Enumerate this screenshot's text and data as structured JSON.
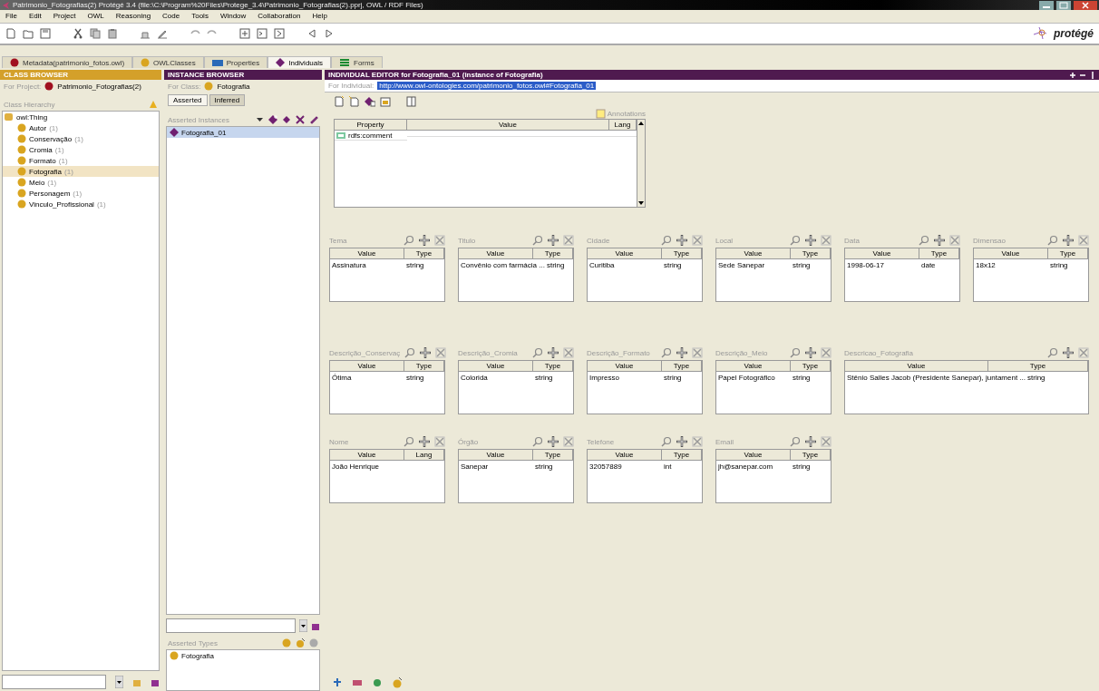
{
  "window": {
    "title": "Patrimonio_Fotografias(2)  Protégé 3.4    (file:\\C:\\Program%20Files\\Protege_3.4\\Patrimonio_Fotografias(2).pprj, OWL / RDF Files)"
  },
  "menu": [
    "File",
    "Edit",
    "Project",
    "OWL",
    "Reasoning",
    "Code",
    "Tools",
    "Window",
    "Collaboration",
    "Help"
  ],
  "logo": {
    "text": "protégé"
  },
  "tabs": [
    {
      "label": "Metadata(patrimonio_fotos.owl)",
      "kind": "metadata",
      "selected": false
    },
    {
      "label": "OWLClasses",
      "kind": "classes",
      "selected": false
    },
    {
      "label": "Properties",
      "kind": "properties",
      "selected": false
    },
    {
      "label": "Individuals",
      "kind": "individuals",
      "selected": true
    },
    {
      "label": "Forms",
      "kind": "forms",
      "selected": false
    }
  ],
  "class_browser": {
    "header": "CLASS BROWSER",
    "project_label": "For Project:",
    "project": "Patrimonio_Fotografias(2)",
    "hierarchy_label": "Class Hierarchy",
    "tree": [
      {
        "label": "owl:Thing",
        "selected": false,
        "children": [
          {
            "label": "Autor",
            "count": "(1)",
            "selected": false
          },
          {
            "label": "Conservação",
            "count": "(1)",
            "selected": false
          },
          {
            "label": "Cromia",
            "count": "(1)",
            "selected": false
          },
          {
            "label": "Formato",
            "count": "(1)",
            "selected": false
          },
          {
            "label": "Fotografia",
            "count": "(1)",
            "selected": true
          },
          {
            "label": "Meio",
            "count": "(1)",
            "selected": false
          },
          {
            "label": "Personagem",
            "count": "(1)",
            "selected": false
          },
          {
            "label": "Vinculo_Profissional",
            "count": "(1)",
            "selected": false
          }
        ]
      }
    ]
  },
  "instance_browser": {
    "header": "INSTANCE BROWSER",
    "class_label": "For Class:",
    "class": "Fotografia",
    "tabs": [
      {
        "label": "Asserted",
        "selected": true
      },
      {
        "label": "Inferred",
        "selected": false
      }
    ],
    "list_label": "Asserted Instances",
    "instances": [
      {
        "label": "Fotografia_01",
        "selected": true
      }
    ],
    "types_label": "Asserted Types",
    "types": [
      "Fotografia"
    ]
  },
  "editor": {
    "header": "INDIVIDUAL EDITOR for Fotografia_01   (instance of Fotografia)",
    "individual_label": "For Individual:",
    "individual": "http://www.owl-ontologies.com/patrimonio_fotos.owl#Fotografia_01",
    "annotations_label": "Annotations",
    "annotation_columns": [
      "Property",
      "Value",
      "Lang"
    ],
    "annotation_rows": [
      {
        "property": "rdfs:comment"
      }
    ],
    "widget_rows": [
      [
        {
          "label": "Tema",
          "kind": "normal",
          "columns": [
            "Value",
            "Type"
          ],
          "rows": [
            [
              "Assinatura",
              "string"
            ]
          ]
        },
        {
          "label": "Titulo",
          "kind": "normal",
          "columns": [
            "Value",
            "Type"
          ],
          "rows": [
            [
              "Convênio com farmácia ...",
              "string"
            ]
          ]
        },
        {
          "label": "Cidade",
          "kind": "normal",
          "columns": [
            "Value",
            "Type"
          ],
          "rows": [
            [
              "Curitiba",
              "string"
            ]
          ]
        },
        {
          "label": "Local",
          "kind": "normal",
          "columns": [
            "Value",
            "Type"
          ],
          "rows": [
            [
              "Sede Sanepar",
              "string"
            ]
          ]
        },
        {
          "label": "Data",
          "kind": "normal",
          "columns": [
            "Value",
            "Type"
          ],
          "rows": [
            [
              "1998-06-17",
              "date"
            ]
          ]
        },
        {
          "label": "Dimensao",
          "kind": "normal",
          "columns": [
            "Value",
            "Type"
          ],
          "rows": [
            [
              "18x12",
              "string"
            ]
          ]
        }
      ],
      [
        {
          "label": "Descrição_Conservaç",
          "kind": "normal",
          "columns": [
            "Value",
            "Type"
          ],
          "rows": [
            [
              "Ótima",
              "string"
            ]
          ]
        },
        {
          "label": "Descrição_Cromia",
          "kind": "normal",
          "columns": [
            "Value",
            "Type"
          ],
          "rows": [
            [
              "Colorida",
              "string"
            ]
          ]
        },
        {
          "label": "Descrição_Formato",
          "kind": "normal",
          "columns": [
            "Value",
            "Type"
          ],
          "rows": [
            [
              "Impresso",
              "string"
            ]
          ]
        },
        {
          "label": "Descrição_Meio",
          "kind": "normal",
          "columns": [
            "Value",
            "Type"
          ],
          "rows": [
            [
              "Papel Fotográfico",
              "string"
            ]
          ]
        },
        {
          "label": "Descricao_Fotografia",
          "kind": "wide",
          "columns": [
            "Value",
            "Type"
          ],
          "rows": [
            [
              "Stênio Salles Jacob (Presidente Sanepar), juntament ...",
              "string"
            ]
          ]
        }
      ],
      [
        {
          "label": "Nome",
          "kind": "normal",
          "columns": [
            "Value",
            "Lang"
          ],
          "rows": [
            [
              "João Henrique"
            ]
          ]
        },
        {
          "label": "Órgão",
          "kind": "normal",
          "columns": [
            "Value",
            "Type"
          ],
          "rows": [
            [
              "Sanepar",
              "string"
            ]
          ]
        },
        {
          "label": "Telefone",
          "kind": "normal",
          "columns": [
            "Value",
            "Type"
          ],
          "rows": [
            [
              "32057889",
              "int"
            ]
          ]
        },
        {
          "label": "Email",
          "kind": "normal",
          "columns": [
            "Value",
            "Type"
          ],
          "rows": [
            [
              "jh@sanepar.com",
              "string"
            ]
          ]
        }
      ]
    ]
  }
}
